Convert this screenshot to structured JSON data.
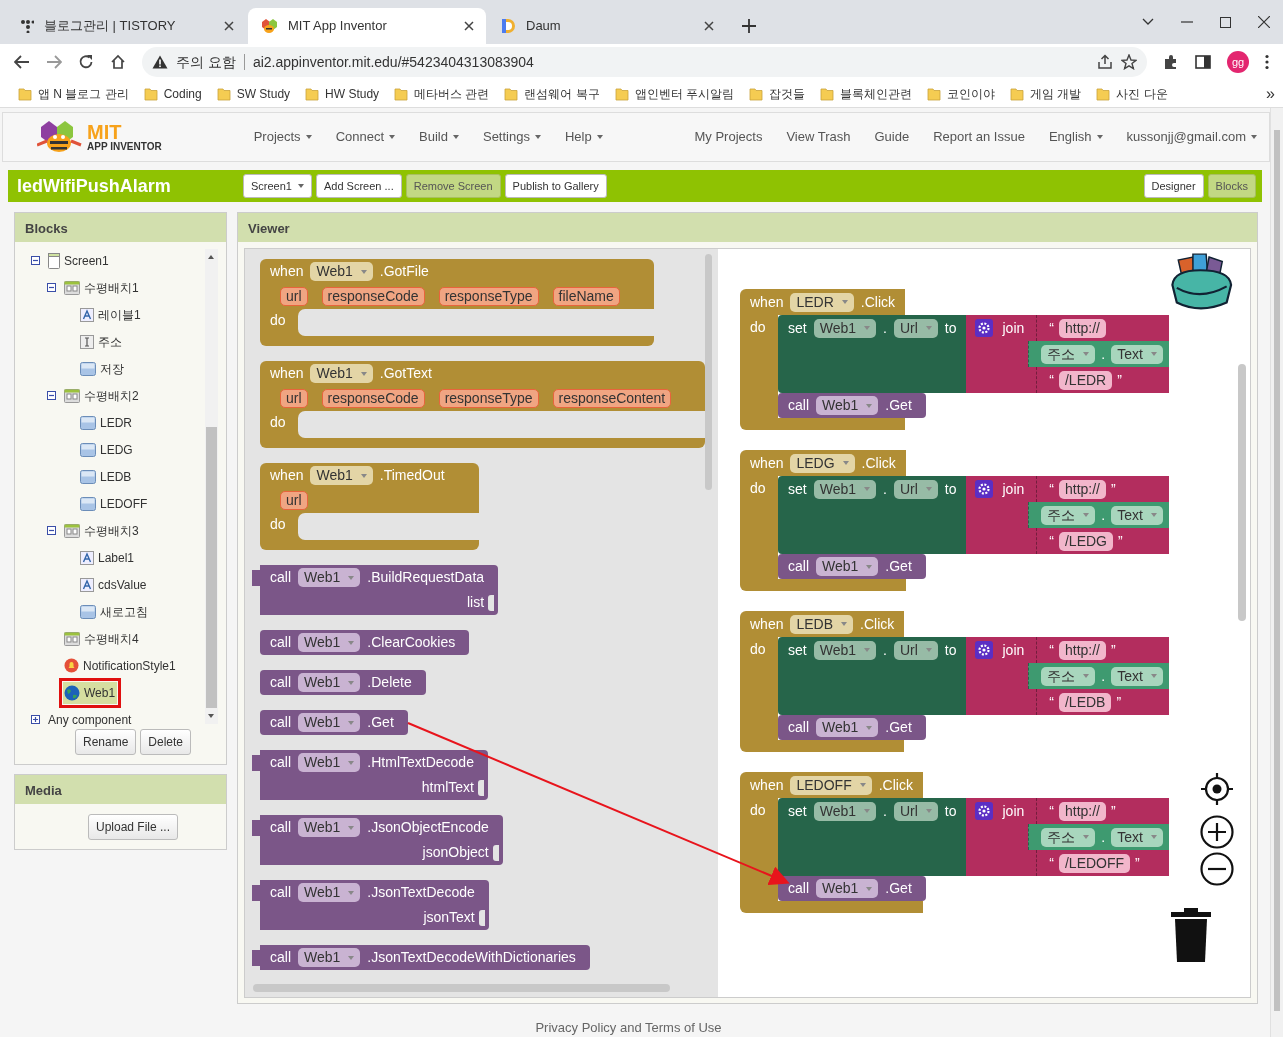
{
  "browser": {
    "tabs": [
      {
        "title": "블로그관리 | TISTORY",
        "selected": false
      },
      {
        "title": "MIT App Inventor",
        "selected": true
      },
      {
        "title": "Daum",
        "selected": false
      }
    ],
    "security_label": "주의 요함",
    "url": "ai2.appinventor.mit.edu/#5423404313083904",
    "profile": "gg",
    "bookmarks": [
      "앱 N 블로그 관리",
      "Coding",
      "SW Study",
      "HW Study",
      "메타버스 관련",
      "랜섬웨어 복구",
      "앱인벤터 푸시알림",
      "잡것들",
      "블록체인관련",
      "코인이야",
      "게임 개발",
      "사진 다운"
    ],
    "bookmarks_more": "»"
  },
  "app": {
    "logo": {
      "title": "MIT",
      "subtitle": "APP INVENTOR"
    },
    "menu": [
      {
        "label": "Projects",
        "dropdown": true
      },
      {
        "label": "Connect",
        "dropdown": true
      },
      {
        "label": "Build",
        "dropdown": true
      },
      {
        "label": "Settings",
        "dropdown": true
      },
      {
        "label": "Help",
        "dropdown": true
      }
    ],
    "right_menu": [
      {
        "label": "My Projects",
        "dropdown": false
      },
      {
        "label": "View Trash",
        "dropdown": false
      },
      {
        "label": "Guide",
        "dropdown": false
      },
      {
        "label": "Report an Issue",
        "dropdown": false
      },
      {
        "label": "English",
        "dropdown": true
      },
      {
        "label": "kussonjj@gmail.com",
        "dropdown": true
      }
    ]
  },
  "toolbar": {
    "project": "ledWifiPushAlarm",
    "buttons": [
      {
        "label": "Screen1",
        "dropdown": true,
        "disabled": false
      },
      {
        "label": "Add Screen ...",
        "dropdown": false,
        "disabled": false
      },
      {
        "label": "Remove Screen",
        "dropdown": false,
        "disabled": true
      },
      {
        "label": "Publish to Gallery",
        "dropdown": false,
        "disabled": false
      }
    ],
    "views": [
      {
        "label": "Designer",
        "selected": false
      },
      {
        "label": "Blocks",
        "selected": true
      }
    ]
  },
  "blocks_panel": {
    "title": "Blocks",
    "tree": [
      {
        "label": "Screen1",
        "kind": "screen",
        "expanded": true,
        "selected": false,
        "children": [
          {
            "label": "수평배치1",
            "kind": "arrangement",
            "expanded": true,
            "selected": false,
            "children": [
              {
                "label": "레이블1",
                "kind": "label",
                "selected": false
              },
              {
                "label": "주소",
                "kind": "textbox",
                "selected": false
              },
              {
                "label": "저장",
                "kind": "button",
                "selected": false
              }
            ]
          },
          {
            "label": "수평배치2",
            "kind": "arrangement",
            "expanded": true,
            "selected": false,
            "children": [
              {
                "label": "LEDR",
                "kind": "button",
                "selected": false
              },
              {
                "label": "LEDG",
                "kind": "button",
                "selected": false
              },
              {
                "label": "LEDB",
                "kind": "button",
                "selected": false
              },
              {
                "label": "LEDOFF",
                "kind": "button",
                "selected": false
              }
            ]
          },
          {
            "label": "수평배치3",
            "kind": "arrangement",
            "expanded": true,
            "selected": false,
            "children": [
              {
                "label": "Label1",
                "kind": "label",
                "selected": false
              },
              {
                "label": "cdsValue",
                "kind": "label",
                "selected": false
              },
              {
                "label": "새로고침",
                "kind": "button",
                "selected": false
              }
            ]
          },
          {
            "label": "수평배치4",
            "kind": "arrangement",
            "selected": false
          },
          {
            "label": "NotificationStyle1",
            "kind": "notifier",
            "selected": false
          },
          {
            "label": "Web1",
            "kind": "web",
            "selected": true
          }
        ]
      },
      {
        "label": "Any component",
        "kind": "group",
        "expanded": false,
        "selected": false
      }
    ],
    "buttons": [
      "Rename",
      "Delete"
    ]
  },
  "media_panel": {
    "title": "Media",
    "button": "Upload File ..."
  },
  "viewer": {
    "title": "Viewer",
    "flyout": [
      {
        "kind": "event",
        "head": "when",
        "component": "Web1",
        "event": ".GotFile",
        "params": [
          "url",
          "responseCode",
          "responseType",
          "fileName"
        ],
        "do": "do"
      },
      {
        "kind": "event",
        "head": "when",
        "component": "Web1",
        "event": ".GotText",
        "params": [
          "url",
          "responseCode",
          "responseType",
          "responseContent"
        ],
        "do": "do"
      },
      {
        "kind": "event",
        "head": "when",
        "component": "Web1",
        "event": ".TimedOut",
        "params": [
          "url"
        ],
        "do": "do"
      },
      {
        "kind": "function",
        "head": "call",
        "component": "Web1",
        "method": ".BuildRequestData",
        "args": [
          "list"
        ]
      },
      {
        "kind": "statement",
        "head": "call",
        "component": "Web1",
        "method": ".ClearCookies"
      },
      {
        "kind": "statement",
        "head": "call",
        "component": "Web1",
        "method": ".Delete"
      },
      {
        "kind": "statement",
        "head": "call",
        "component": "Web1",
        "method": ".Get"
      },
      {
        "kind": "function",
        "head": "call",
        "component": "Web1",
        "method": ".HtmlTextDecode",
        "args": [
          "htmlText"
        ]
      },
      {
        "kind": "function",
        "head": "call",
        "component": "Web1",
        "method": ".JsonObjectEncode",
        "args": [
          "jsonObject"
        ]
      },
      {
        "kind": "function",
        "head": "call",
        "component": "Web1",
        "method": ".JsonTextDecode",
        "args": [
          "jsonText"
        ]
      },
      {
        "kind": "function",
        "head": "call",
        "component": "Web1",
        "method": ".JsonTextDecodeWithDictionaries"
      }
    ],
    "workspace": [
      {
        "head": "when",
        "component": "LEDR",
        "event": ".Click",
        "do": "do",
        "set": {
          "head": "set",
          "component": "Web1",
          "dot": ".",
          "property": "Url",
          "to": "to"
        },
        "join": {
          "label": "join",
          "items": [
            {
              "kind": "text",
              "open": "“",
              "value": "http://"
            },
            {
              "kind": "getter",
              "component": "주소",
              "dot": ".",
              "property": "Text"
            },
            {
              "kind": "text",
              "open": "“",
              "value": "/LEDR",
              "close": "”"
            }
          ]
        },
        "call": {
          "head": "call",
          "component": "Web1",
          "method": ".Get"
        }
      },
      {
        "head": "when",
        "component": "LEDG",
        "event": ".Click",
        "do": "do",
        "set": {
          "head": "set",
          "component": "Web1",
          "dot": ".",
          "property": "Url",
          "to": "to"
        },
        "join": {
          "label": "join",
          "items": [
            {
              "kind": "text",
              "open": "“",
              "value": "http://",
              "close": "”"
            },
            {
              "kind": "getter",
              "component": "주소",
              "dot": ".",
              "property": "Text"
            },
            {
              "kind": "text",
              "open": "“",
              "value": "/LEDG",
              "close": "”"
            }
          ]
        },
        "call": {
          "head": "call",
          "component": "Web1",
          "method": ".Get"
        }
      },
      {
        "head": "when",
        "component": "LEDB",
        "event": ".Click",
        "do": "do",
        "set": {
          "head": "set",
          "component": "Web1",
          "dot": ".",
          "property": "Url",
          "to": "to"
        },
        "join": {
          "label": "join",
          "items": [
            {
              "kind": "text",
              "open": "“",
              "value": "http://",
              "close": "”"
            },
            {
              "kind": "getter",
              "component": "주소",
              "dot": ".",
              "property": "Text"
            },
            {
              "kind": "text",
              "open": "“",
              "value": "/LEDB",
              "close": "”"
            }
          ]
        },
        "call": {
          "head": "call",
          "component": "Web1",
          "method": ".Get"
        }
      },
      {
        "head": "when",
        "component": "LEDOFF",
        "event": ".Click",
        "do": "do",
        "set": {
          "head": "set",
          "component": "Web1",
          "dot": ".",
          "property": "Url",
          "to": "to"
        },
        "join": {
          "label": "join",
          "items": [
            {
              "kind": "text",
              "open": "“",
              "value": "http://",
              "close": "”"
            },
            {
              "kind": "getter",
              "component": "주소",
              "dot": ".",
              "property": "Text"
            },
            {
              "kind": "text",
              "open": "“",
              "value": "/LEDOFF",
              "close": "”"
            }
          ]
        },
        "call": {
          "head": "call",
          "component": "Web1",
          "method": ".Get"
        }
      }
    ]
  },
  "footer": "Privacy Policy and Terms of Use"
}
